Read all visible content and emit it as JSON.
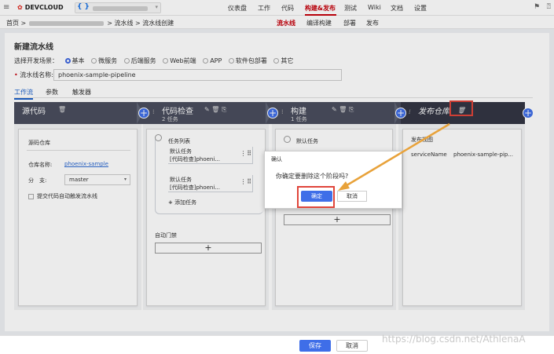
{
  "topbar": {
    "logo": "DEVCLOUD",
    "project_icon": "{ }",
    "nav": [
      "仪表盘",
      "工作",
      "代码",
      "构建&发布",
      "测试",
      "Wiki",
      "文档",
      "设置"
    ],
    "active_nav": "构建&发布"
  },
  "breadcrumb": {
    "home": "首页 >",
    "path": "> 流水线 > 流水线创建",
    "subnav": [
      "流水线",
      "编译构建",
      "部署",
      "发布"
    ]
  },
  "page": {
    "title": "新建流水线",
    "scene_label": "选择开发场景：",
    "scenes": [
      "基本",
      "微服务",
      "后端服务",
      "Web前端",
      "APP",
      "软件包部署",
      "其它"
    ],
    "name_label": "流水线名称:",
    "name_value": "phoenix-sample-pipeline",
    "tabs": [
      "工作流",
      "参数",
      "触发器"
    ]
  },
  "stages": [
    {
      "name": "源代码",
      "count": ""
    },
    {
      "name": "代码检查",
      "count": "2 任务"
    },
    {
      "name": "构建",
      "count": "1 任务"
    },
    {
      "name": "发布仓库",
      "count": ""
    }
  ],
  "source_card": {
    "title": "源码仓库",
    "repo_label": "仓库名称:",
    "repo_value": "phoenix-sample",
    "branch_label": "分　支:",
    "branch_value": "master",
    "auto_trigger": "提交代码自动触发流水线"
  },
  "check_card": {
    "tasklist": "任务列表",
    "tasks": [
      {
        "name": "默认任务",
        "desc": "[代码检查]phoeni..."
      },
      {
        "name": "默认任务",
        "desc": "[代码检查]phoeni..."
      }
    ],
    "add_task": "添加任务",
    "gate": "自动门禁"
  },
  "build_card": {
    "task": "默认任务"
  },
  "publish_card": {
    "title": "发布视图",
    "service_label": "serviceName",
    "service_value": "phoenix-sample-pip..."
  },
  "dialog": {
    "title": "确认",
    "message": "你确定要删除这个阶段吗?",
    "ok": "确定",
    "cancel": "取消"
  },
  "footer": {
    "save": "保存",
    "cancel": "取消"
  },
  "watermark": "https://blog.csdn.net/AthlenaA",
  "colors": {
    "brand": "#c7000b",
    "primary": "#3f6ee8",
    "stagebar": "#4a4e5e",
    "highlight": "#e0453a",
    "arrow": "#e8a23a"
  }
}
